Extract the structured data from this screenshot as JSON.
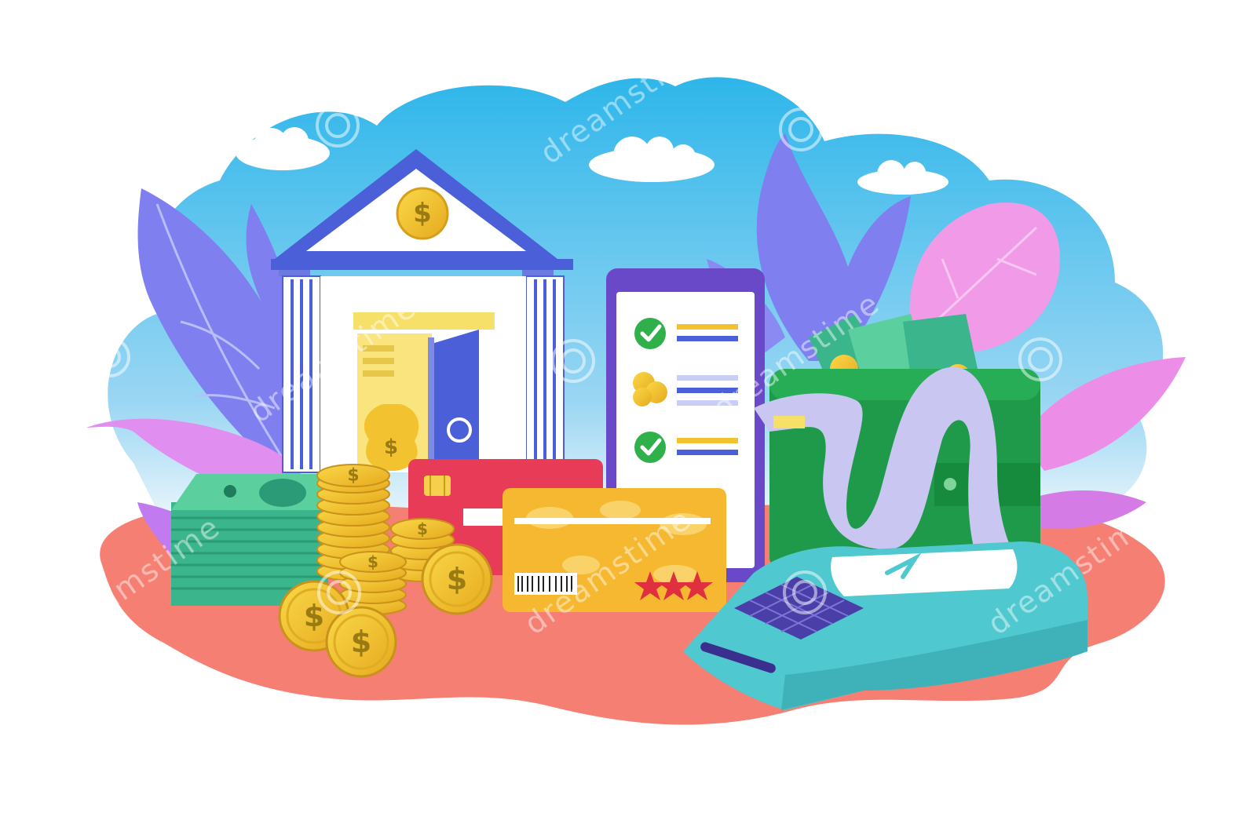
{
  "illustration": {
    "subject": "banking-and-payments-flat-illustration",
    "currency_symbol": "$",
    "card_rating_stars": 3,
    "checklist_items": [
      {
        "type": "check"
      },
      {
        "type": "coins"
      },
      {
        "type": "check"
      }
    ]
  },
  "watermark": {
    "brand": "dreamstime",
    "text": "dreamstime"
  },
  "palette": {
    "sky_top": "#2eb6ea",
    "sky_bottom": "#cfe9f7",
    "ground": "#f57f72",
    "leaf_purple": "#7f7ff0",
    "leaf_pink": "#f09ae8",
    "bank_blue": "#4a5fd8",
    "coin_gold": "#f2c230",
    "card_red": "#e83b57",
    "card_gold": "#f5b830",
    "cash_green": "#3ab58c",
    "wallet_green": "#1f9a4a",
    "terminal_teal": "#4fc8cf",
    "receipt_lilac": "#c9c6f2",
    "phone_purple": "#6a49c9",
    "check_green": "#2fb04a"
  }
}
